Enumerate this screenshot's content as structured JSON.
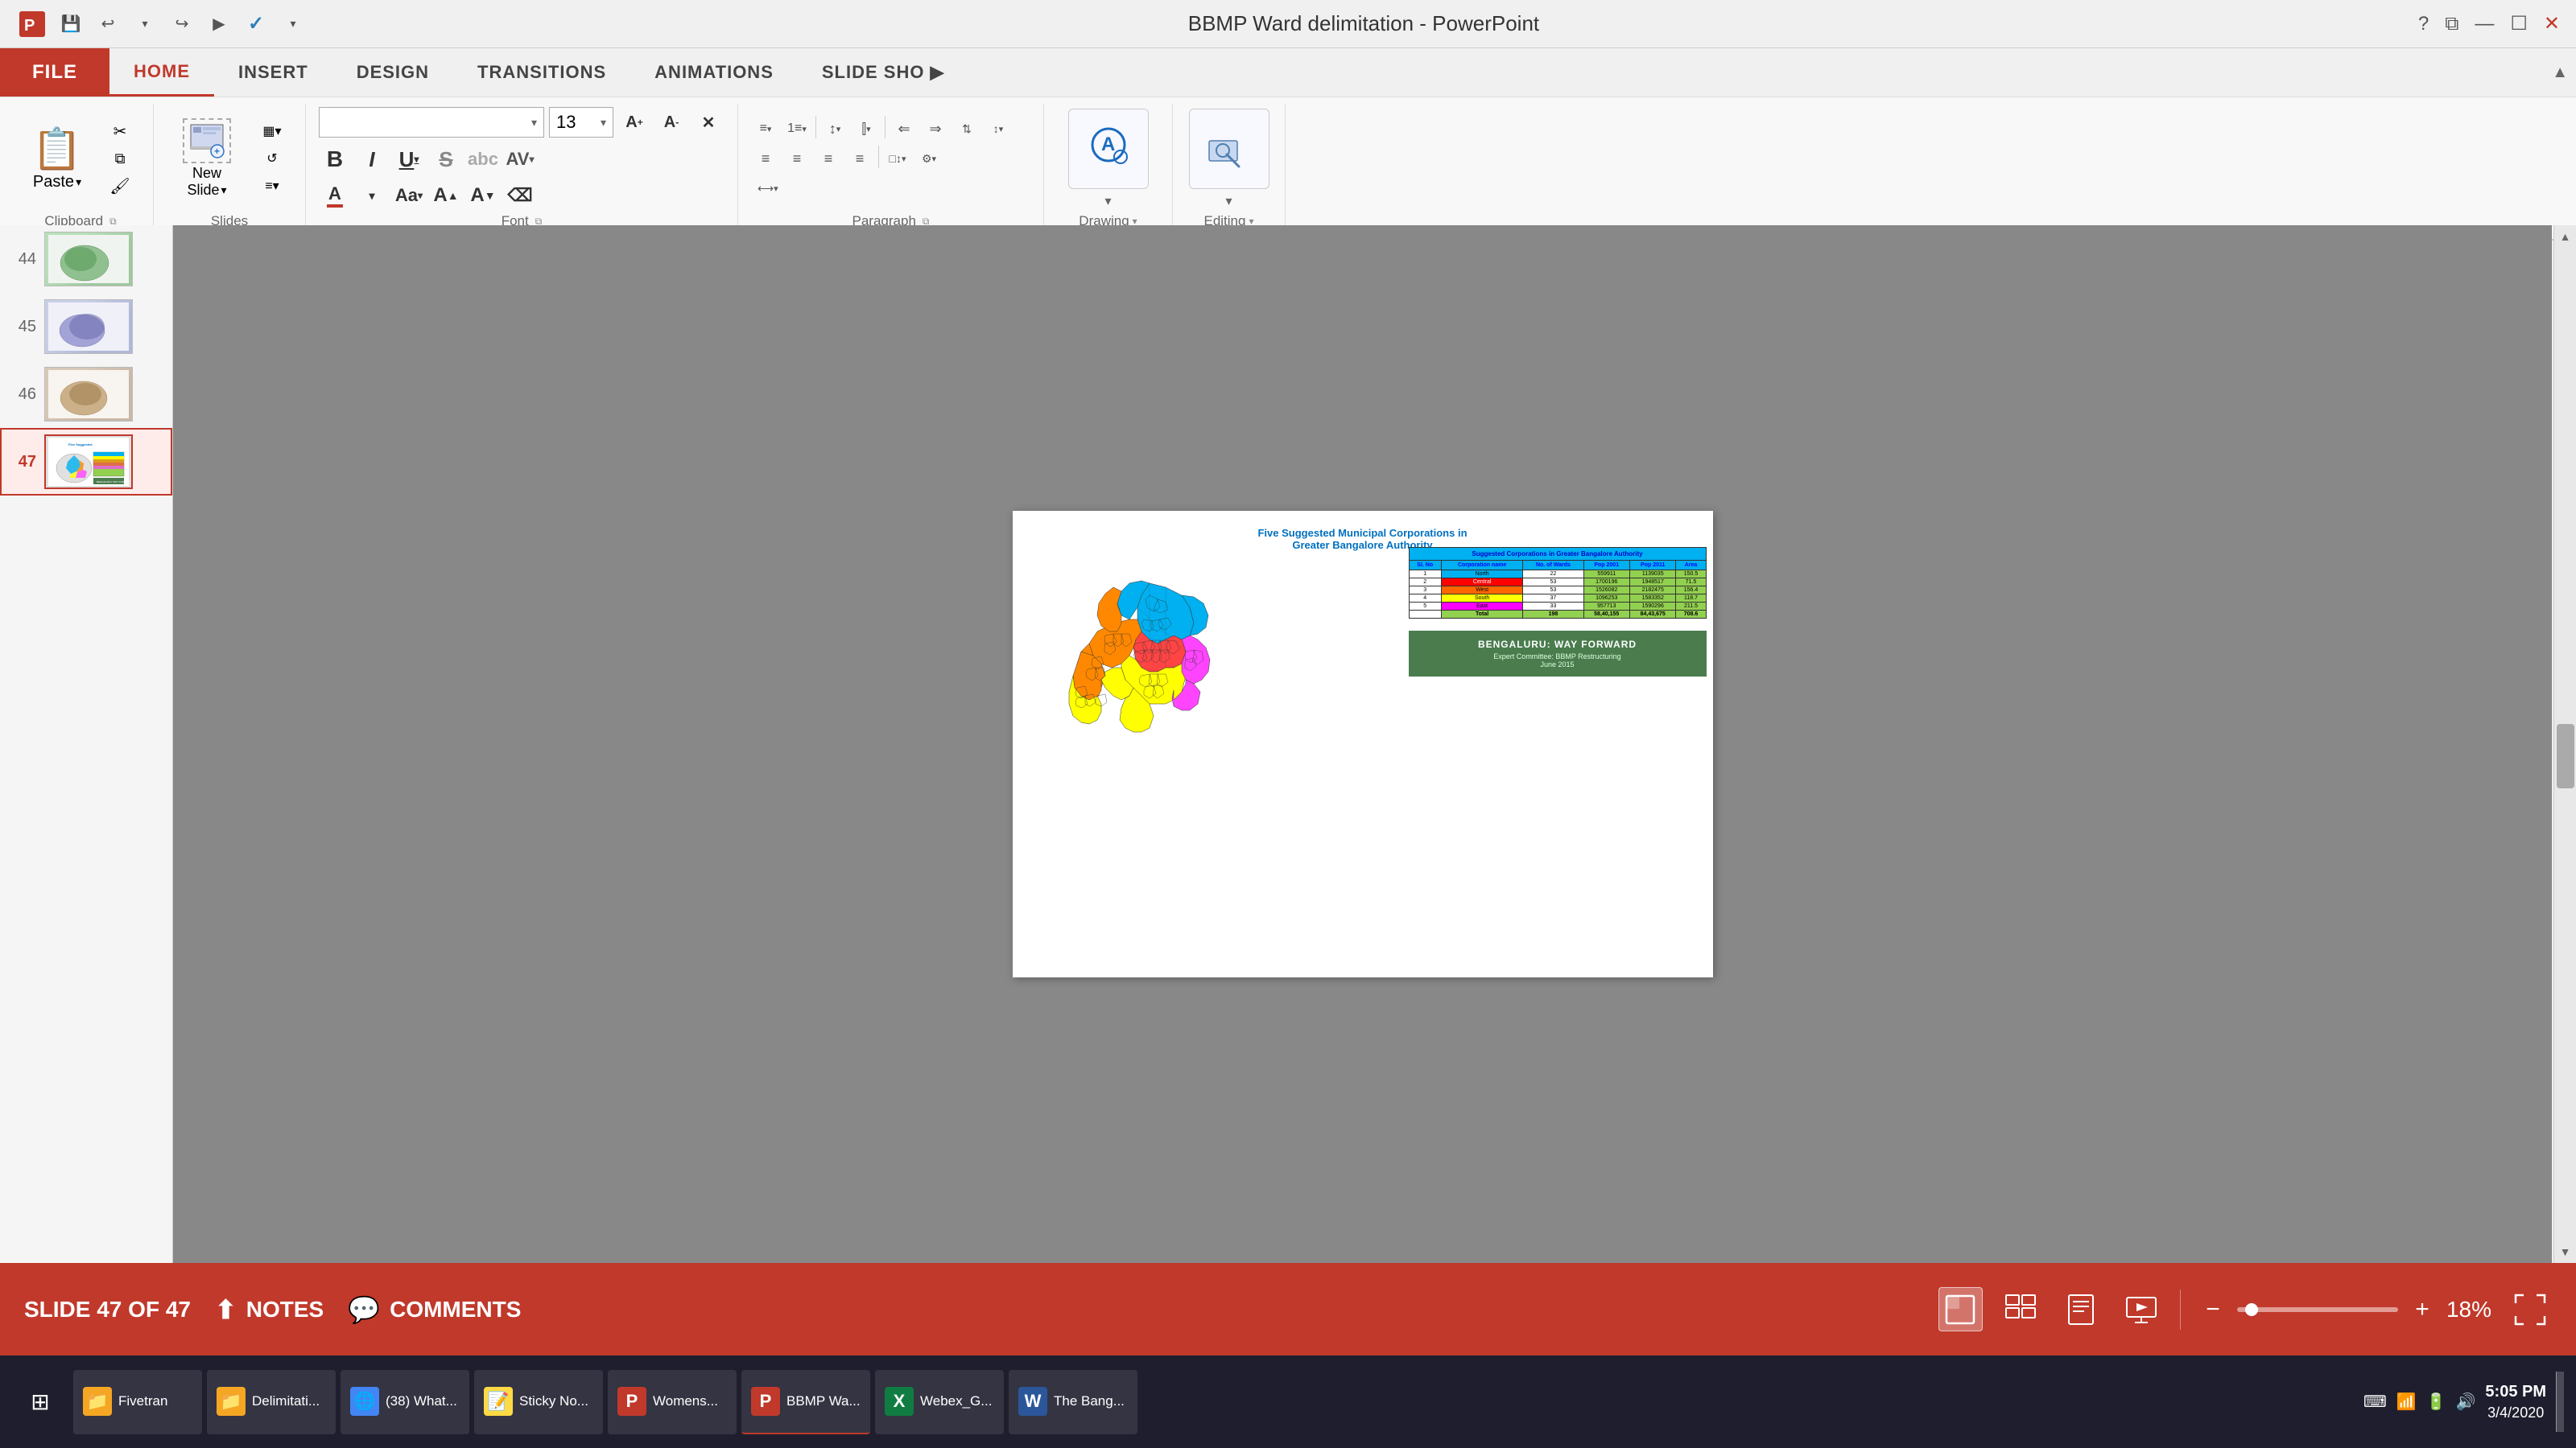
{
  "app": {
    "title": "BBMP Ward delimitation - PowerPoint",
    "ppt_icon": "P"
  },
  "titlebar": {
    "help_icon": "?",
    "restore_icon": "⧉",
    "minimize_icon": "—",
    "maximize_icon": "☐",
    "close_icon": "✕"
  },
  "quickaccess": {
    "save_label": "💾",
    "undo_label": "↩",
    "undo_arrow": "↩",
    "redo_label": "↪",
    "present_label": "▶",
    "check_label": "✓",
    "dropdown_label": "▾"
  },
  "ribbon": {
    "tabs": [
      {
        "id": "file",
        "label": "FILE",
        "active": false,
        "is_file": true
      },
      {
        "id": "home",
        "label": "HOME",
        "active": true
      },
      {
        "id": "insert",
        "label": "INSERT",
        "active": false
      },
      {
        "id": "design",
        "label": "DESIGN",
        "active": false
      },
      {
        "id": "transitions",
        "label": "TRANSITIONS",
        "active": false
      },
      {
        "id": "animations",
        "label": "ANIMATIONS",
        "active": false
      },
      {
        "id": "slideshow",
        "label": "SLIDE SHO",
        "active": false
      },
      {
        "id": "more",
        "label": "▶",
        "active": false
      }
    ],
    "groups": {
      "clipboard": {
        "label": "Clipboard",
        "paste_label": "Paste",
        "cut_label": "✂",
        "copy_label": "⧉",
        "format_label": "🖌"
      },
      "slides": {
        "label": "Slides",
        "new_slide_label": "New\nSlide",
        "layout_label": "▦",
        "reset_label": "↺",
        "section_label": "§"
      },
      "font": {
        "label": "Font",
        "font_name": "",
        "font_size": "13",
        "bold": "B",
        "italic": "I",
        "underline": "U",
        "strikethrough": "S",
        "shadow": "abc",
        "spacing": "AV",
        "font_color": "A",
        "font_case": "Aa",
        "increase_size": "A↑",
        "decrease_size": "A↓",
        "clear_format": "🧹",
        "expand_icon": "⧉"
      },
      "paragraph": {
        "label": "Paragraph",
        "expand_icon": "⧉"
      },
      "drawing": {
        "label": "Drawing",
        "icon": "A"
      },
      "editing": {
        "label": "Editing",
        "icon": "🔭"
      }
    }
  },
  "slides_panel": {
    "thumbnails": [
      {
        "num": "44",
        "active": false
      },
      {
        "num": "45",
        "active": false
      },
      {
        "num": "46",
        "active": false
      },
      {
        "num": "47",
        "active": true
      }
    ]
  },
  "slide47": {
    "title_line1": "Five Suggested Municipal Corporations in",
    "title_line2": "Greater Bangalore Authority",
    "table_header": "Suggested Corporations in Greater Bangalore Authority",
    "table_cols": [
      "Sl. No",
      "Corporation name",
      "No. of Wards",
      "Pop 2001",
      "Pop 2011",
      "Area"
    ],
    "table_rows": [
      {
        "num": "1",
        "name": "North",
        "wards": "22",
        "pop2001": "559911",
        "pop2011": "1139035",
        "area": "150.5",
        "color": "north"
      },
      {
        "num": "2",
        "name": "Central",
        "wards": "53",
        "pop2001": "1700196",
        "pop2011": "1948517",
        "area": "71.5",
        "color": "central"
      },
      {
        "num": "3",
        "name": "West",
        "wards": "53",
        "pop2001": "1526082",
        "pop2011": "2182475",
        "area": "156.4",
        "color": "west"
      },
      {
        "num": "4",
        "name": "South",
        "wards": "37",
        "pop2001": "1096253",
        "pop2011": "1583352",
        "area": "118.7",
        "color": "south"
      },
      {
        "num": "5",
        "name": "East",
        "wards": "33",
        "pop2001": "957713",
        "pop2011": "1590296",
        "area": "211.5",
        "color": "east"
      }
    ],
    "table_total": {
      "name": "Total",
      "wards": "198",
      "pop2001": "58,40,155",
      "pop2011": "84,43,675",
      "area": "708.6"
    },
    "banner_line1": "BENGALURU: WAY FORWARD",
    "banner_line2": "Expert Committee: BBMP Restructuring",
    "banner_line3": "June 2015"
  },
  "statusbar": {
    "slide_info": "SLIDE 47 OF 47",
    "notes_label": "NOTES",
    "comments_label": "COMMENTS",
    "zoom_value": "18%"
  },
  "taskbar": {
    "start_icon": "⊞",
    "items": [
      {
        "label": "Fivetran",
        "icon": "📁",
        "color": "#f5a623"
      },
      {
        "label": "Delimitati...",
        "icon": "📁",
        "color": "#f5a623"
      },
      {
        "label": "(38) What...",
        "icon": "🌐",
        "color": "#4285f4"
      },
      {
        "label": "Sticky No...",
        "icon": "📝",
        "color": "#ffda44"
      },
      {
        "label": "Womens...",
        "icon": "P",
        "color": "#c0392b"
      },
      {
        "label": "BBMP Wa...",
        "icon": "P",
        "color": "#c0392b"
      },
      {
        "label": "Webex_G...",
        "icon": "X",
        "color": "#107c41"
      },
      {
        "label": "The Bang...",
        "icon": "W",
        "color": "#2b579a"
      }
    ],
    "time": "5:05 PM",
    "date": "3/4/2020",
    "keyboard_icon": "⌨",
    "network_icon": "📶",
    "sound_icon": "🔊"
  }
}
